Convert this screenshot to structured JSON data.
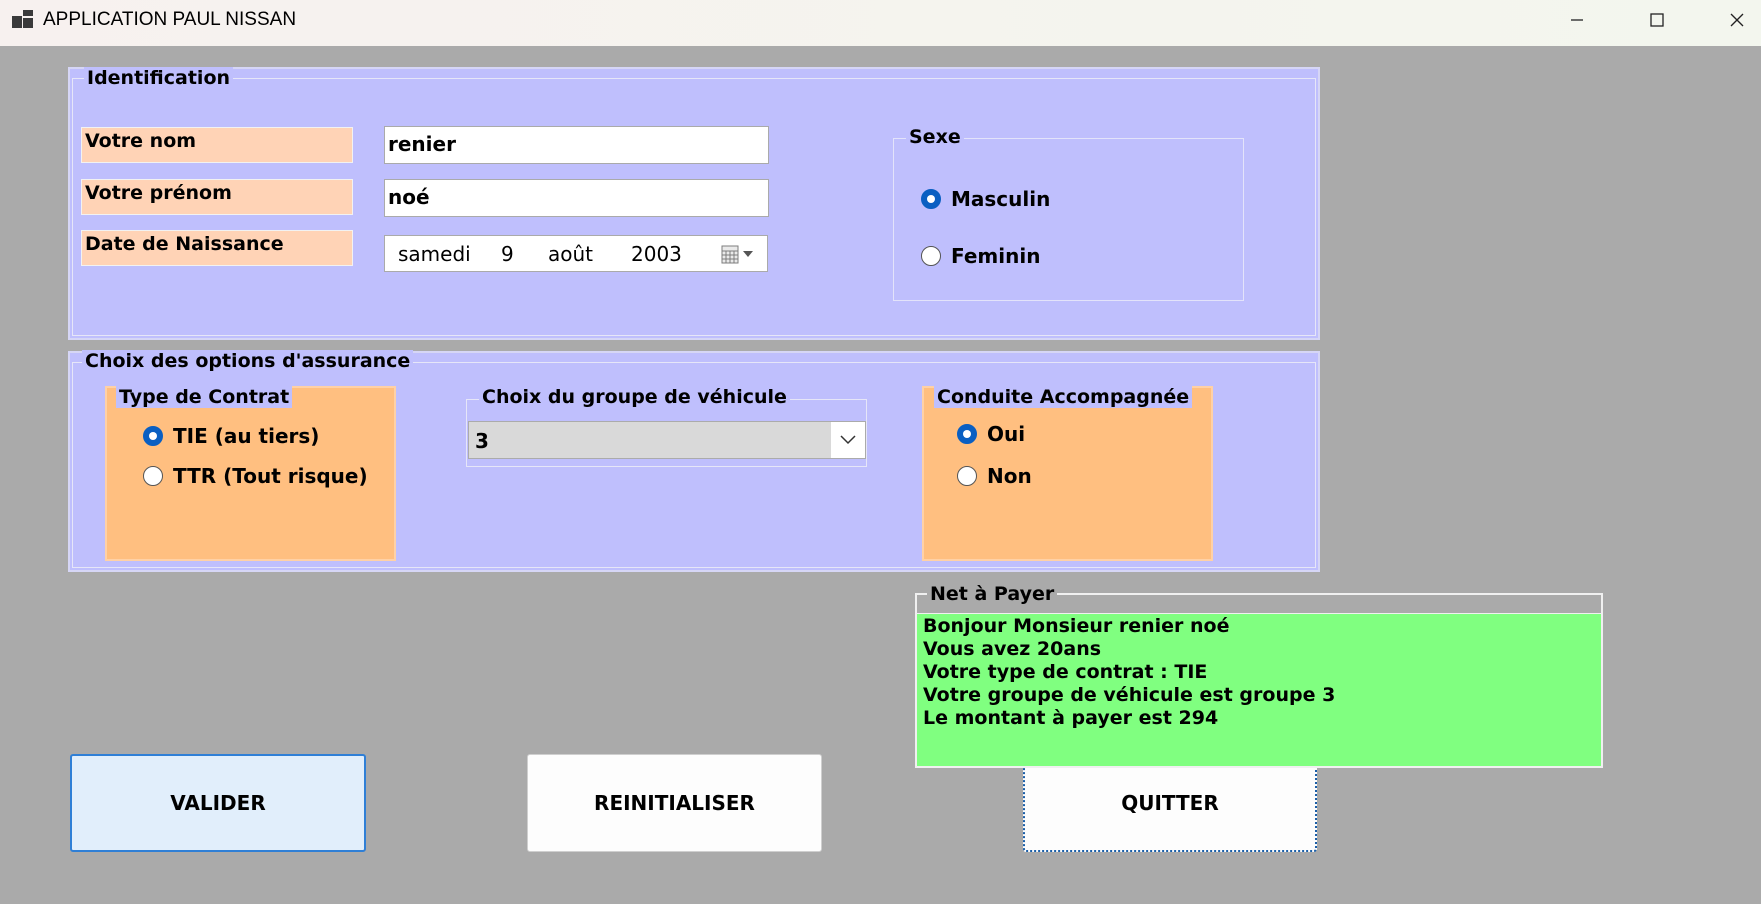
{
  "window": {
    "title": "APPLICATION PAUL NISSAN"
  },
  "identification": {
    "title": "Identification",
    "nom_label": "Votre nom",
    "nom_value": "renier",
    "prenom_label": "Votre prénom",
    "prenom_value": "noé",
    "naissance_label": "Date de Naissance",
    "date": {
      "day_name": "samedi",
      "day": "9",
      "month": "août",
      "year": "2003"
    }
  },
  "sexe": {
    "title": "Sexe",
    "options": [
      {
        "label": "Masculin",
        "selected": true
      },
      {
        "label": "Feminin",
        "selected": false
      }
    ]
  },
  "options": {
    "title": "Choix des options d'assurance",
    "contrat": {
      "title": "Type de Contrat",
      "options": [
        {
          "label": "TIE (au tiers)",
          "selected": true
        },
        {
          "label": "TTR (Tout risque)",
          "selected": false
        }
      ]
    },
    "groupe": {
      "title": "Choix du groupe de véhicule",
      "selected": "3"
    },
    "conduite": {
      "title": "Conduite Accompagnée",
      "options": [
        {
          "label": "Oui",
          "selected": true
        },
        {
          "label": "Non",
          "selected": false
        }
      ]
    }
  },
  "net": {
    "title": "Net à Payer",
    "lines": [
      "Bonjour Monsieur renier noé",
      "Vous avez 20ans",
      "Votre type de contrat : TIE",
      "Votre groupe de véhicule est groupe 3",
      "Le montant à payer est 294"
    ]
  },
  "buttons": {
    "valider": "VALIDER",
    "reinitialiser": "REINITIALISER",
    "quitter": "QUITTER"
  },
  "colors": {
    "panel": "#bfbffd",
    "label_bg": "#ffd3b6",
    "orange": "#ffbf80",
    "result_bg": "#80ff80",
    "radio_on": "#0a5fc2"
  }
}
